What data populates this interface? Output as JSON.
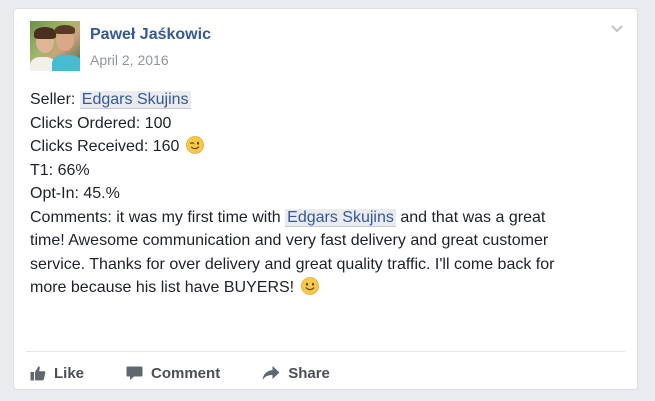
{
  "post": {
    "author": "Paweł Jaśkowic",
    "date": "April 2, 2016",
    "lines": {
      "seller_prefix": "Seller: ",
      "seller_name": "Edgars Skujins",
      "clicks_ordered": "Clicks Ordered: 100",
      "clicks_received": "Clicks Received: 160",
      "t1": "T1: 66%",
      "opt_in": "Opt-In: 45.%",
      "comments_prefix": "Comments: it was my first time with ",
      "comments_mention": "Edgars Skujins",
      "comments_suffix": " and that was a great",
      "line_2": "time! Awesome communication and very fast delivery and great customer",
      "line_3": "service. Thanks for over delivery and great quality traffic. I'll come back for",
      "line_4": "more because his list have BUYERS!"
    }
  },
  "actions": {
    "like": "Like",
    "comment": "Comment",
    "share": "Share"
  },
  "icons": {
    "like": "thumbs-up-icon",
    "comment": "speech-bubble-icon",
    "share": "share-arrow-icon",
    "options": "chevron-down-icon",
    "wink": "wink-emoji-icon",
    "smile": "smile-emoji-icon"
  },
  "colors": {
    "link": "#365899",
    "text": "#1d2129",
    "meta": "#90949c",
    "action": "#4b4f56",
    "background": "#e9ebee"
  }
}
